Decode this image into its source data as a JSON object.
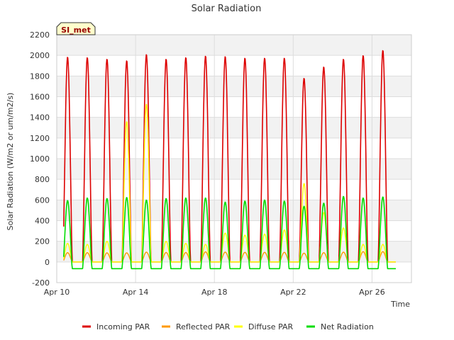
{
  "chart_data": {
    "type": "line",
    "title": "Solar Radiation",
    "xlabel": "Time",
    "ylabel": "Solar Radiation (W/m2 or um/m2/s)",
    "badge": "SI_met",
    "ylim": [
      -200,
      2200
    ],
    "yticks": [
      -200,
      0,
      200,
      400,
      600,
      800,
      1000,
      1200,
      1400,
      1600,
      1800,
      2000,
      2200
    ],
    "xlim": [
      "2024-04-10",
      "2024-04-28"
    ],
    "xticks": [
      {
        "date": "2024-04-10",
        "label": "Apr 10"
      },
      {
        "date": "2024-04-14",
        "label": "Apr 14"
      },
      {
        "date": "2024-04-18",
        "label": "Apr 18"
      },
      {
        "date": "2024-04-22",
        "label": "Apr 22"
      },
      {
        "date": "2024-04-26",
        "label": "Apr 26"
      }
    ],
    "grid": true,
    "legend_position": "bottom",
    "days": [
      "2024-04-10",
      "2024-04-11",
      "2024-04-12",
      "2024-04-13",
      "2024-04-14",
      "2024-04-15",
      "2024-04-16",
      "2024-04-17",
      "2024-04-18",
      "2024-04-19",
      "2024-04-20",
      "2024-04-21",
      "2024-04-22",
      "2024-04-23",
      "2024-04-24",
      "2024-04-25",
      "2024-04-26",
      "2024-04-27"
    ],
    "series": [
      {
        "name": "Incoming PAR",
        "color": "#dd0000",
        "daily_peak": [
          1985,
          1980,
          1965,
          1950,
          2010,
          1965,
          1980,
          1995,
          1990,
          1975,
          1975,
          1975,
          1780,
          1890,
          1965,
          2000,
          2050,
          0
        ]
      },
      {
        "name": "Reflected PAR",
        "color": "#ff9900",
        "daily_peak": [
          90,
          90,
          88,
          88,
          95,
          92,
          92,
          98,
          95,
          93,
          93,
          93,
          85,
          90,
          95,
          100,
          100,
          0
        ]
      },
      {
        "name": "Diffuse PAR",
        "color": "#ffff00",
        "daily_peak": [
          180,
          170,
          200,
          1360,
          1530,
          200,
          180,
          170,
          280,
          260,
          270,
          310,
          760,
          480,
          330,
          170,
          170,
          0
        ]
      },
      {
        "name": "Net Radiation",
        "color": "#00dd00",
        "daily_peak": [
          595,
          620,
          615,
          625,
          600,
          615,
          620,
          620,
          580,
          590,
          600,
          590,
          540,
          570,
          635,
          620,
          630,
          0
        ],
        "night_value": -65
      }
    ]
  }
}
